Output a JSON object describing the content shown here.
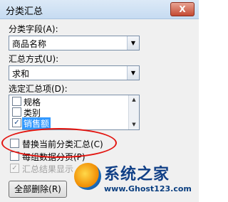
{
  "window": {
    "title": "分类汇总",
    "close_label": "X"
  },
  "group_by": {
    "label": "分类字段(A):",
    "value": "商品名称"
  },
  "function": {
    "label": "汇总方式(U):",
    "value": "求和"
  },
  "add_subtotal": {
    "label": "选定汇总项(D):",
    "items": [
      {
        "label": "规格",
        "checked": false
      },
      {
        "label": "类别",
        "checked": false
      },
      {
        "label": "销售额",
        "checked": true
      }
    ]
  },
  "options": {
    "replace_current": "替换当前分类汇总(C)",
    "page_break": "每组数据分页(P)",
    "summary_below": "汇总结果显示"
  },
  "buttons": {
    "remove_all": "全部删除(R)"
  },
  "watermark": {
    "name": "系统之家",
    "url": "www.Ghost123.com"
  },
  "colors": {
    "highlight": "#e3140f",
    "selection": "#3399ff"
  }
}
